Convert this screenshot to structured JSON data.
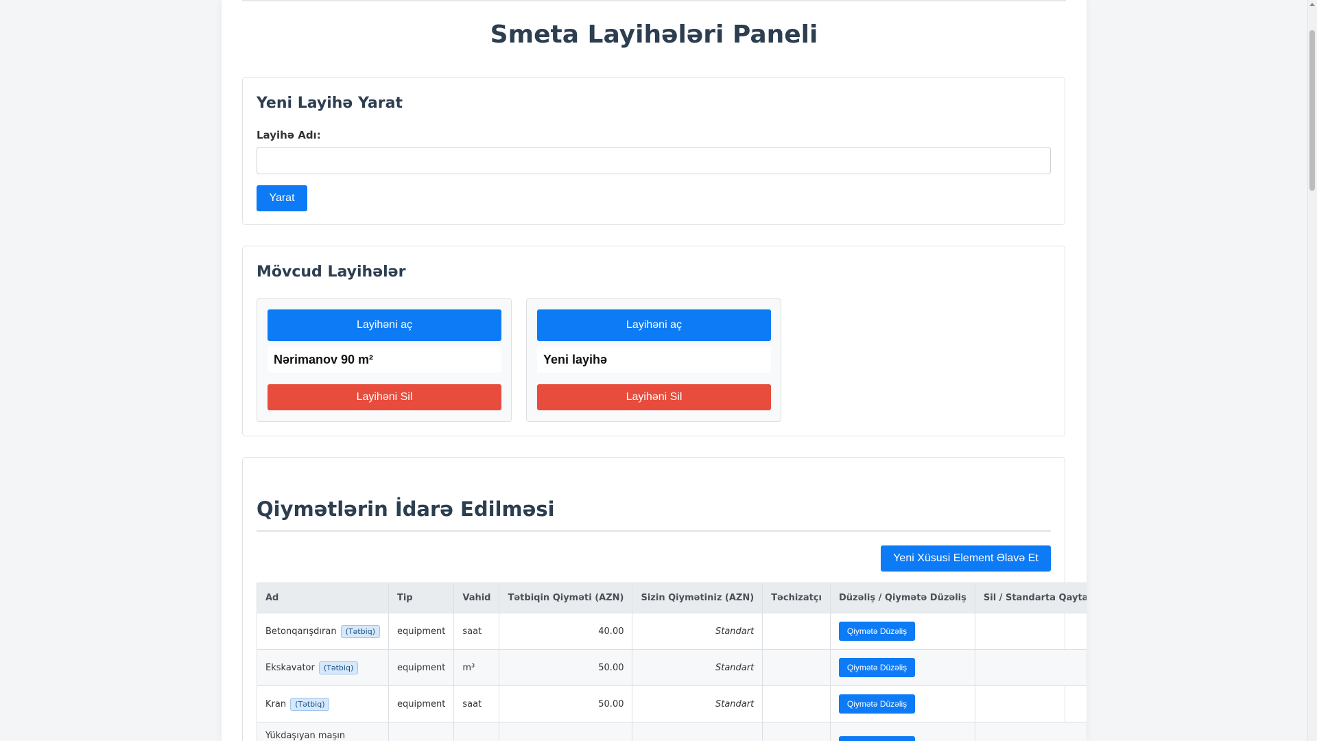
{
  "page": {
    "title": "Smeta Layihələri Paneli"
  },
  "create": {
    "heading": "Yeni Layihə Yarat",
    "label": "Layihə Adı:",
    "input_value": "",
    "button": "Yarat"
  },
  "projects": {
    "heading": "Mövcud Layihələr",
    "items": [
      {
        "open_label": "Layihəni aç",
        "name": "Nərimanov 90 m²",
        "delete_label": "Layihəni Sil"
      },
      {
        "open_label": "Layihəni aç",
        "name": "Yeni layihə",
        "delete_label": "Layihəni Sil"
      }
    ]
  },
  "prices": {
    "heading": "Qiymətlərin İdarə Edilməsi",
    "add_button": "Yeni Xüsusi Element Əlavə Et",
    "columns": [
      "Ad",
      "Tip",
      "Vahid",
      "Tətbiqin Qiyməti (AZN)",
      "Sizin Qiymətiniz (AZN)",
      "Təchizatçı",
      "Düzəliş / Qiymətə Düzəliş",
      "Sil / Standarta Qaytar"
    ],
    "rows": [
      {
        "name": "Betonqarışdıran",
        "badge": "(Tətbiq)",
        "type": "equipment",
        "unit": "saat",
        "app_price": "40.00",
        "your_price": "Standart",
        "supplier": "",
        "edit_label": "Qiymətə Düzəliş",
        "delete": ""
      },
      {
        "name": "Ekskavator",
        "badge": "(Tətbiq)",
        "type": "equipment",
        "unit": "m³",
        "app_price": "50.00",
        "your_price": "Standart",
        "supplier": "",
        "edit_label": "Qiymətə Düzəliş",
        "delete": ""
      },
      {
        "name": "Kran",
        "badge": "(Tətbiq)",
        "type": "equipment",
        "unit": "saat",
        "app_price": "50.00",
        "your_price": "Standart",
        "supplier": "",
        "edit_label": "Qiymətə Düzəliş",
        "delete": ""
      },
      {
        "name": "Yükdaşıyan maşın",
        "badge": "",
        "type": "",
        "unit": "",
        "app_price": "",
        "your_price": "",
        "supplier": "",
        "edit_label": "",
        "delete": ""
      }
    ]
  }
}
